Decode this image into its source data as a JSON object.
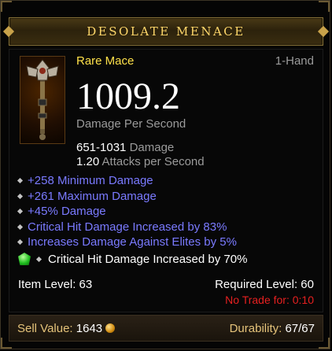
{
  "item": {
    "name": "DESOLATE MENACE",
    "type": "Rare Mace",
    "hand": "1-Hand",
    "dps": "1009.2",
    "dps_label": "Damage Per Second",
    "damage_value": "651-1031",
    "damage_label": "Damage",
    "aps_value": "1.20",
    "aps_label": "Attacks per Second",
    "icon": "mace-icon"
  },
  "affixes": [
    "+258 Minimum Damage",
    "+261 Maximum Damage",
    "+45% Damage",
    "Critical Hit Damage Increased by 83%",
    "Increases Damage Against Elites by 5%"
  ],
  "gem": {
    "icon": "emerald-gem-icon",
    "text": "Critical Hit Damage Increased by 70%"
  },
  "levels": {
    "item_level": "Item Level: 63",
    "required_level": "Required Level: 60",
    "no_trade": "No Trade for: 0:10"
  },
  "footer": {
    "sell_label": "Sell Value:",
    "sell_value": "1643",
    "coin_icon": "gold-coin-icon",
    "durability_label": "Durability:",
    "durability_value": "67/67"
  },
  "colors": {
    "title": "#ffd76a",
    "item_type": "#ffe14a",
    "affix": "#7a7aff",
    "no_trade": "#e62020"
  }
}
